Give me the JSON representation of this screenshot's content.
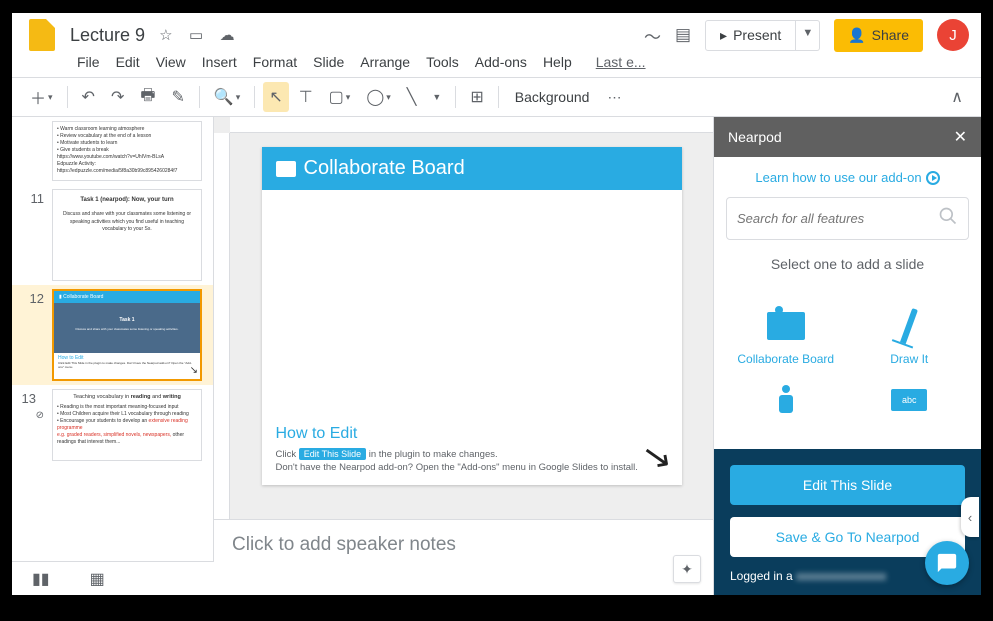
{
  "doc": {
    "title": "Lecture 9",
    "last_edit": "Last e..."
  },
  "menu": {
    "file": "File",
    "edit": "Edit",
    "view": "View",
    "insert": "Insert",
    "format": "Format",
    "slide": "Slide",
    "arrange": "Arrange",
    "tools": "Tools",
    "addons": "Add-ons",
    "help": "Help"
  },
  "actions": {
    "present": "Present",
    "share": "Share",
    "avatar": "J"
  },
  "toolbar": {
    "background": "Background",
    "more": "⋯"
  },
  "filmstrip": {
    "t10_lines": "• Warm classroom learning atmosphere\n• Review vocabulary at the end of a lesson\n• Motivate students to learn\n• Give students a break\nhttps://www.youtube.com/watch?v=UhIVm-BLsA\nEdpuzzle Activity:\nhttps://edpuzzle.com/media/5f8a30b99c8954260284f7",
    "n11": "11",
    "t11_title": "Task 1 (nearpod): Now, your turn",
    "t11_body": "Discuss and share with your classmates some listening or speaking activities which you find useful in teaching vocabulary to your Ss.",
    "n12": "12",
    "t12_head": "▮ Collaborate Board",
    "t12_task": "Task 1",
    "t12_foot_title": "How to Edit",
    "t12_foot_body": "Click Edit This Slide in the plugin to make changes.\nDon't have the Nearpod add-on? Open the \"Add-ons\" menu.",
    "n13": "13",
    "t13_title": "Teaching vocabulary in reading and writing",
    "t13_b1": "Reading is the most important meaning-focused input",
    "t13_b2": "Most Children acquire their L1 vocabulary through reading",
    "t13_b3": "Encourage your students to develop an extensive reading programme",
    "t13_b4": "e.g. graded readers, simplified novels, newspapers, other readings that interest them."
  },
  "slide": {
    "header": "Collaborate Board",
    "task_title": "Task 1",
    "task_body": "Discuss and share with your classmates some listening or speaking activities which you find useful in teaching vocabulary to your Ss.",
    "howto_title": "How to Edit",
    "howto_l1a": "Click",
    "howto_l1_badge": "Edit This Slide",
    "howto_l1b": "in the plugin to make changes.",
    "howto_l2": "Don't have the Nearpod add-on? Open the \"Add-ons\" menu in Google Slides to install."
  },
  "notes": {
    "placeholder": "Click to add speaker notes"
  },
  "sidepanel": {
    "title": "Nearpod",
    "learn": "Learn how to use our add-on",
    "search_placeholder": "Search for all features",
    "prompt": "Select one to add a slide",
    "item1": "Collaborate Board",
    "item2": "Draw It",
    "abc": "abc",
    "btn_edit": "Edit This Slide",
    "btn_save": "Save & Go To Nearpod",
    "login": "Logged in a"
  }
}
